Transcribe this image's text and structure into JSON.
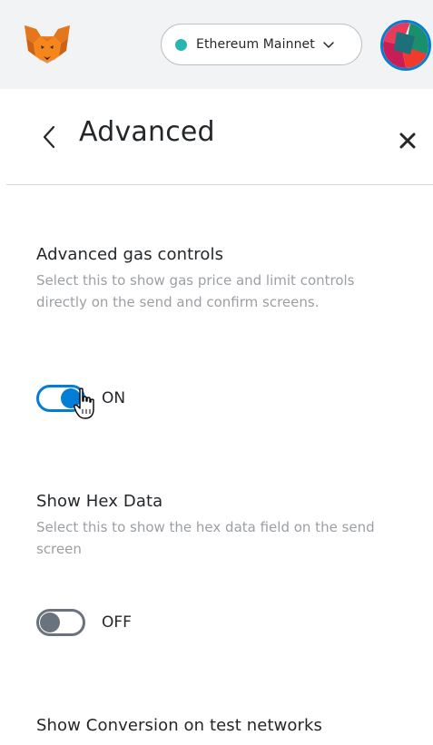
{
  "header": {
    "logo_icon": "metamask-fox-icon",
    "network": {
      "label": "Ethereum Mainnet",
      "dot_color": "#29b6af",
      "chevron_icon": "chevron-down-icon"
    },
    "account_icon": "account-identicon"
  },
  "page": {
    "title": "Advanced",
    "back_icon": "chevron-left-icon",
    "close_icon": "close-icon"
  },
  "settings": [
    {
      "title": "Advanced gas controls",
      "description": "Select this to show gas price and limit controls directly on the send and confirm screens.",
      "toggle_state": "ON",
      "enabled": true
    },
    {
      "title": "Show Hex Data",
      "description": "Select this to show the hex data field on the send screen",
      "toggle_state": "OFF",
      "enabled": false
    },
    {
      "title": "Show Conversion on test networks"
    }
  ],
  "colors": {
    "accent": "#037dd6",
    "text_primary": "#24272a",
    "text_secondary": "#9b9fa4",
    "toggle_off": "#6a737d",
    "header_bg": "#f2f3f4"
  }
}
